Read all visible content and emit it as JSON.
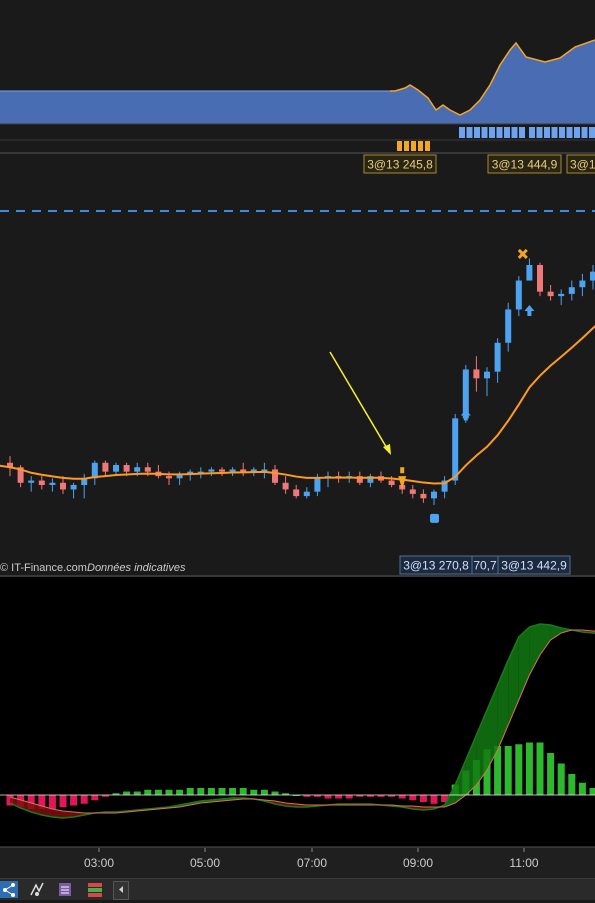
{
  "copyright": "© IT-Finance.com",
  "disclaimer": "Données indicatives",
  "top_labels": [
    {
      "text": "3@13 245,8"
    },
    {
      "text": "3@13 444,9"
    },
    {
      "text": "3@1"
    }
  ],
  "bottom_labels": [
    {
      "text": "3@13 270,8"
    },
    {
      "text": "70,7"
    },
    {
      "text": "3@13 442,9"
    }
  ],
  "colors": {
    "up": "#4da3f0",
    "down": "#f07878",
    "ma": "#ff9a1f",
    "volume_area": "#4a6cb3",
    "macd_green": "#2db82d",
    "macd_red": "#e0185a",
    "dashed_line": "#3c8be0",
    "arrow": "#f5f032",
    "signal_orange": "#f5a623"
  },
  "chart_data": {
    "type": "candlestick",
    "x_axis": {
      "tick_labels": [
        "03:00",
        "05:00",
        "07:00",
        "09:00",
        "11:00"
      ]
    },
    "candles": [
      [
        13268,
        13271,
        13262,
        13266
      ],
      [
        13266,
        13267,
        13257,
        13259
      ],
      [
        13259,
        13262,
        13255,
        13260
      ],
      [
        13260,
        13262,
        13256,
        13258
      ],
      [
        13258,
        13261,
        13255,
        13259
      ],
      [
        13259,
        13262,
        13254,
        13256
      ],
      [
        13256,
        13259,
        13252,
        13258
      ],
      [
        13258,
        13263,
        13252,
        13261
      ],
      [
        13261,
        13269,
        13258,
        13268
      ],
      [
        13268,
        13269,
        13262,
        13264
      ],
      [
        13264,
        13268,
        13262,
        13267
      ],
      [
        13267,
        13268,
        13262,
        13264
      ],
      [
        13264,
        13268,
        13262,
        13266
      ],
      [
        13266,
        13268,
        13262,
        13264
      ],
      [
        13264,
        13267,
        13261,
        13262
      ],
      [
        13262,
        13264,
        13258,
        13261
      ],
      [
        13261,
        13264,
        13258,
        13263
      ],
      [
        13263,
        13265,
        13260,
        13264
      ],
      [
        13264,
        13266,
        13261,
        13264
      ],
      [
        13264,
        13266,
        13262,
        13265
      ],
      [
        13265,
        13266,
        13262,
        13264
      ],
      [
        13264,
        13266,
        13262,
        13265
      ],
      [
        13265,
        13268,
        13262,
        13264
      ],
      [
        13264,
        13266,
        13262,
        13265
      ],
      [
        13265,
        13268,
        13261,
        13265
      ],
      [
        13265,
        13267,
        13258,
        13259
      ],
      [
        13259,
        13262,
        13254,
        13256
      ],
      [
        13256,
        13258,
        13252,
        13253
      ],
      [
        13253,
        13257,
        13252,
        13255
      ],
      [
        13255,
        13263,
        13253,
        13261
      ],
      [
        13261,
        13264,
        13257,
        13262
      ],
      [
        13262,
        13264,
        13259,
        13261
      ],
      [
        13261,
        13264,
        13259,
        13262
      ],
      [
        13262,
        13264,
        13258,
        13259
      ],
      [
        13259,
        13263,
        13257,
        13262
      ],
      [
        13262,
        13264,
        13259,
        13260
      ],
      [
        13260,
        13262,
        13257,
        13258
      ],
      [
        13258,
        13260,
        13254,
        13256
      ],
      [
        13256,
        13258,
        13252,
        13254
      ],
      [
        13254,
        13256,
        13250,
        13252
      ],
      [
        13252,
        13256,
        13249,
        13255
      ],
      [
        13255,
        13262,
        13252,
        13260
      ],
      [
        13260,
        13290,
        13258,
        13288
      ],
      [
        13288,
        13312,
        13286,
        13310
      ],
      [
        13310,
        13316,
        13300,
        13306
      ],
      [
        13306,
        13311,
        13298,
        13309
      ],
      [
        13309,
        13324,
        13304,
        13322
      ],
      [
        13322,
        13340,
        13318,
        13337
      ],
      [
        13337,
        13352,
        13334,
        13350
      ],
      [
        13350,
        13360,
        13350,
        13357
      ],
      [
        13357,
        13358,
        13343,
        13345
      ],
      [
        13345,
        13348,
        13341,
        13343
      ],
      [
        13343,
        13346,
        13339,
        13344
      ],
      [
        13344,
        13350,
        13341,
        13347
      ],
      [
        13347,
        13353,
        13343,
        13350
      ],
      [
        13350,
        13357,
        13346,
        13354
      ],
      [
        13354,
        13360,
        13351,
        13357
      ]
    ],
    "moving_average": [
      13266,
      13265,
      13263.5,
      13262.6,
      13261.9,
      13261.2,
      13260.8,
      13260.8,
      13261.6,
      13262,
      13262.5,
      13262.7,
      13263,
      13263.1,
      13263,
      13262.8,
      13262.8,
      13262.9,
      13263.1,
      13263.3,
      13263.4,
      13263.6,
      13263.7,
      13263.8,
      13263.9,
      13263.4,
      13262.7,
      13261.8,
      13261.2,
      13261.2,
      13261.3,
      13261.3,
      13261.4,
      13261.2,
      13261.3,
      13261.2,
      13260.9,
      13260.4,
      13259.8,
      13259.1,
      13258.7,
      13258.8,
      13261.7,
      13266.8,
      13271.2,
      13275.2,
      13280.4,
      13286.9,
      13294.2,
      13301.9,
      13307.2,
      13311.7,
      13315.7,
      13319.8,
      13324.1,
      13328.6,
      13332.9
    ],
    "macd_histogram": [
      -6,
      -7,
      -8,
      -8,
      -8,
      -7,
      -6,
      -5,
      -3,
      -1,
      1,
      2,
      2,
      3,
      3,
      3,
      3,
      4,
      4,
      4,
      4,
      4,
      4,
      3,
      3,
      2,
      1,
      0,
      -1,
      -1,
      -2,
      -2,
      -2,
      -1,
      -1,
      -1,
      -1,
      -2,
      -3,
      -4,
      -5,
      -4,
      6,
      14,
      20,
      26,
      28,
      28,
      29,
      30,
      30,
      24,
      18,
      12,
      7,
      4,
      2
    ],
    "macd_line": [
      -8,
      -13,
      -17,
      -20,
      -22,
      -23,
      -22,
      -20,
      -18,
      -17,
      -17,
      -16,
      -15,
      -14,
      -13,
      -12,
      -10,
      -8,
      -6,
      -5,
      -4,
      -3,
      -3,
      -4,
      -6,
      -9,
      -11,
      -12,
      -12,
      -11,
      -10,
      -9,
      -9,
      -9,
      -9,
      -10,
      -11,
      -12,
      -14,
      -15,
      -14,
      -10,
      10,
      35,
      60,
      85,
      110,
      135,
      158,
      168,
      171,
      170,
      167,
      165,
      163,
      162,
      161
    ],
    "signal_line": [
      -2,
      -5,
      -8,
      -11,
      -14,
      -16,
      -17,
      -18,
      -18,
      -18,
      -18,
      -17,
      -16,
      -15,
      -14,
      -13,
      -12,
      -10,
      -8,
      -7,
      -6,
      -5,
      -4,
      -4,
      -5,
      -6,
      -8,
      -9,
      -10,
      -10,
      -10,
      -10,
      -10,
      -10,
      -10,
      -10,
      -10,
      -11,
      -11,
      -12,
      -12,
      -12,
      -8,
      0,
      10,
      25,
      45,
      70,
      95,
      120,
      140,
      155,
      162,
      165,
      165,
      164,
      163
    ]
  }
}
